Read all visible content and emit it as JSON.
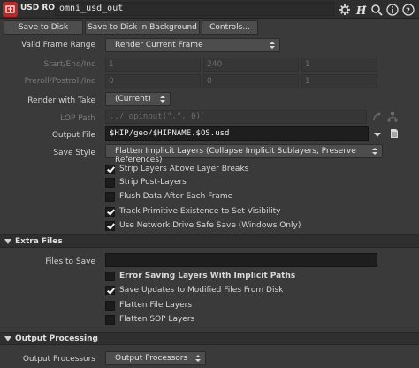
{
  "header": {
    "node_type": "USD ROP",
    "node_name": "omni_usd_out",
    "icons": [
      "usd-rop-node-icon",
      "gear-icon",
      "houdini-help-icon",
      "search-icon",
      "info-icon",
      "help-icon"
    ]
  },
  "toolbar": {
    "save_to_disk": "Save to Disk",
    "save_bg": "Save to Disk in Background",
    "controls": "Controls..."
  },
  "params": {
    "valid_frame_range": {
      "label": "Valid Frame Range",
      "value": "Render Current Frame"
    },
    "start_end_inc": {
      "label": "Start/End/Inc",
      "v1": "1",
      "v2": "240",
      "v3": "1"
    },
    "preroll": {
      "label": "Preroll/Postroll/Inc",
      "v1": "0",
      "v2": "0",
      "v3": "1"
    },
    "render_with_take": {
      "label": "Render with Take",
      "value": "(Current)"
    },
    "lop_path": {
      "label": "LOP Path",
      "value": "../`opinput(\".\", 0)`"
    },
    "output_file": {
      "label": "Output File",
      "value": "$HIP/geo/$HIPNAME.$OS.usd"
    },
    "save_style": {
      "label": "Save Style",
      "value": "Flatten Implicit Layers (Collapse Implicit Sublayers, Preserve References)"
    }
  },
  "checkboxes_main": [
    {
      "label": "Strip Layers Above Layer Breaks",
      "checked": true
    },
    {
      "label": "Strip Post-Layers",
      "checked": false
    },
    {
      "label": "Flush Data After Each Frame",
      "checked": false
    },
    {
      "label": "Track Primitive Existence to Set Visibility",
      "checked": true
    },
    {
      "label": "Use Network Drive Safe Save (Windows Only)",
      "checked": true
    }
  ],
  "extra_files": {
    "title": "Extra Files",
    "files_to_save_label": "Files to Save",
    "files_to_save_value": "",
    "checkboxes": [
      {
        "label": "Error Saving Layers With Implicit Paths",
        "checked": false,
        "bold": true
      },
      {
        "label": "Save Updates to Modified Files From Disk",
        "checked": true,
        "bold": false
      },
      {
        "label": "Flatten File Layers",
        "checked": false,
        "bold": false
      },
      {
        "label": "Flatten SOP Layers",
        "checked": false,
        "bold": false
      }
    ]
  },
  "output_processing": {
    "title": "Output Processing",
    "processors_label": "Output Processors",
    "processors_value": "Output Processors"
  },
  "colors": {
    "background": "#3a3a3a",
    "node_icon": "#b42a2a",
    "field_dark": "#1e1e1e"
  }
}
